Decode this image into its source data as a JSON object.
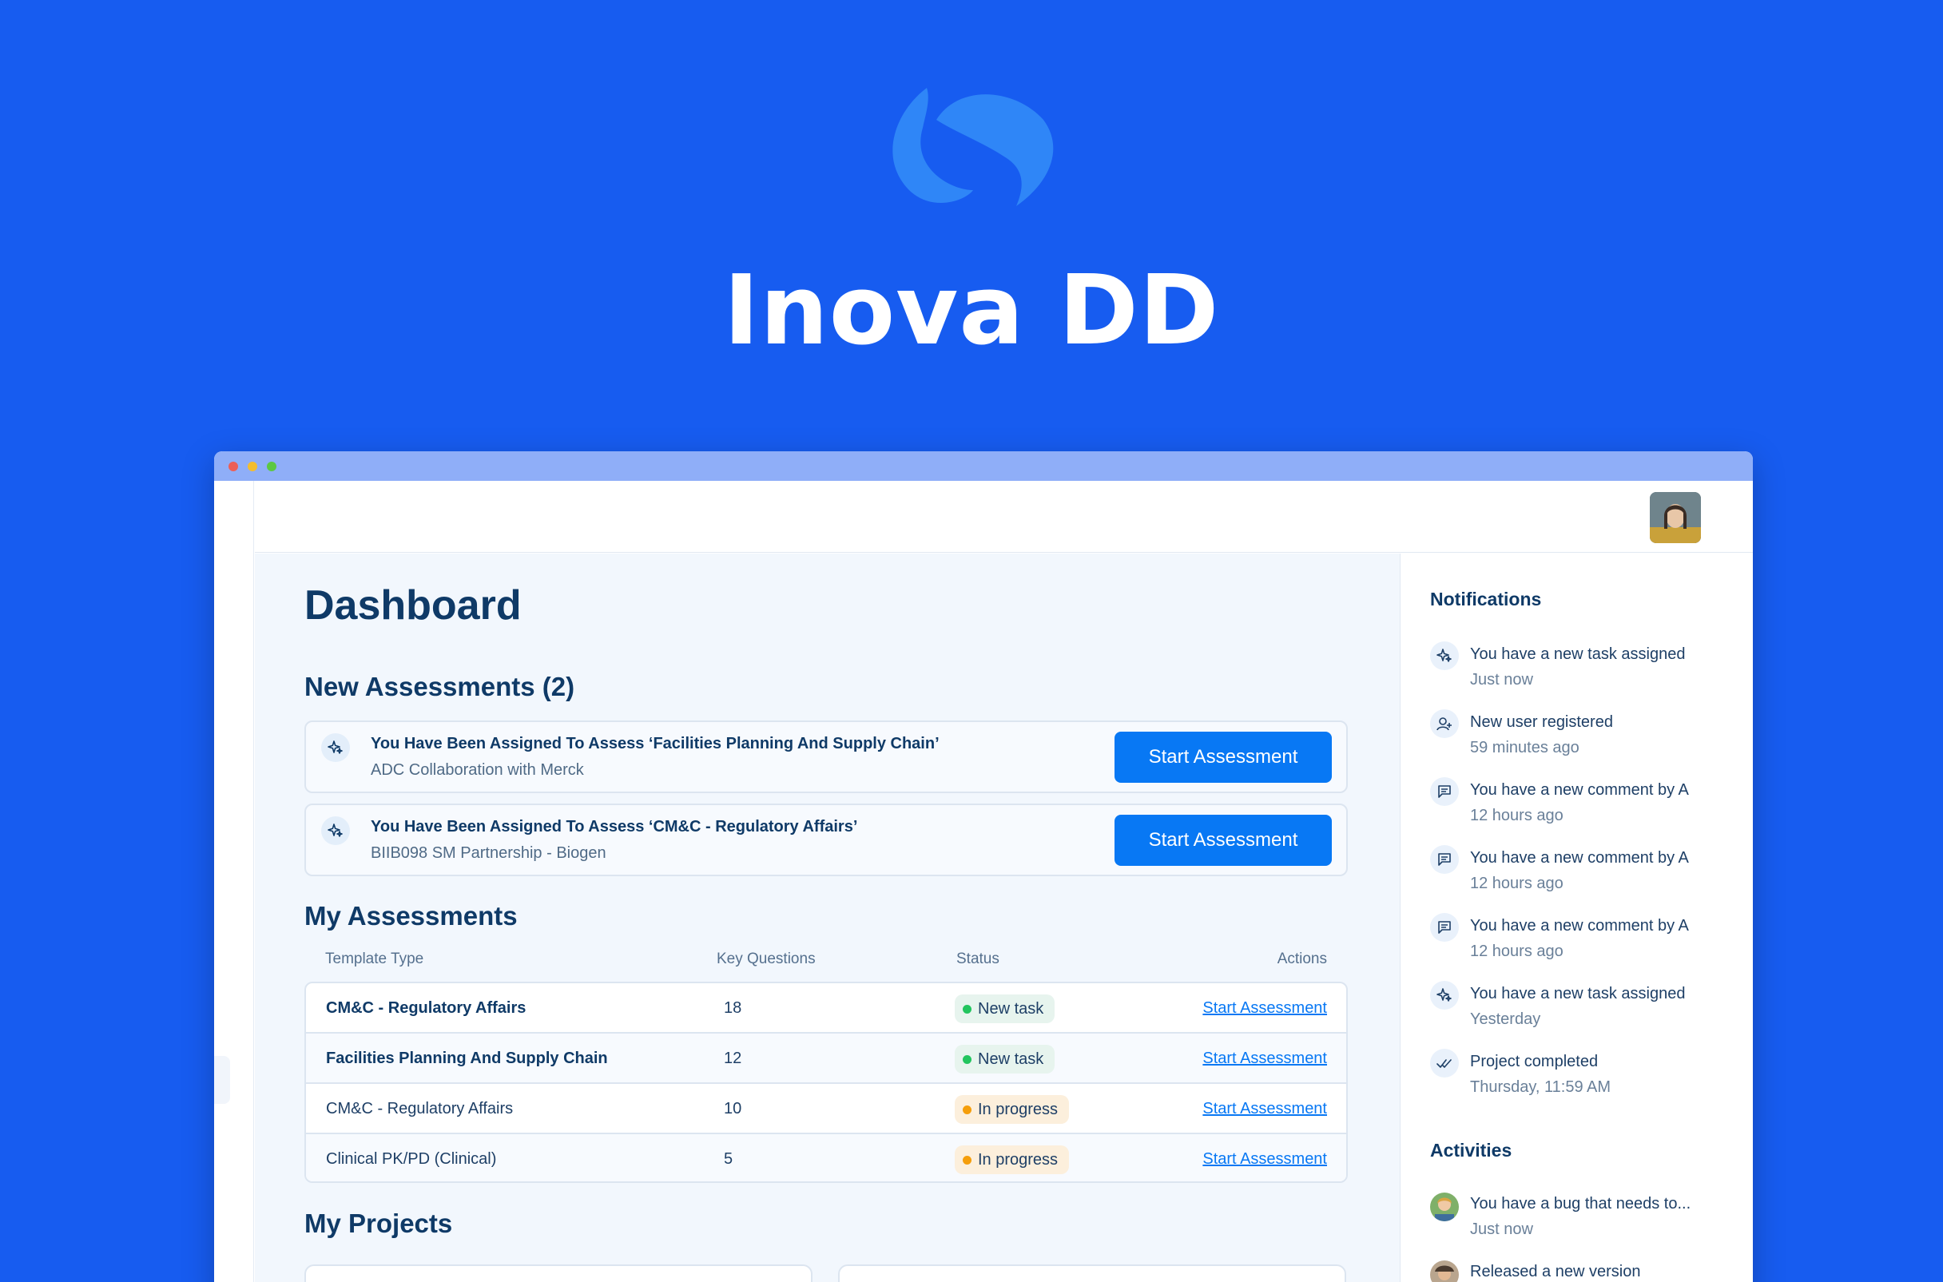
{
  "hero": {
    "title": "Inova DD",
    "logo_icon": "inova-logo-icon",
    "background_color": "#175CF0"
  },
  "window": {
    "traffic_lights": [
      "#EC5E56",
      "#F3BD2E",
      "#5CC842"
    ],
    "user_avatar": "user-avatar"
  },
  "dashboard": {
    "title": "Dashboard",
    "new_assessments": {
      "heading": "New Assessments (2)",
      "items": [
        {
          "title": "You Have Been Assigned To Assess ‘Facilities Planning And Supply Chain’",
          "subtitle": "ADC Collaboration with Merck",
          "button": "Start Assessment"
        },
        {
          "title": "You Have Been Assigned To Assess ‘CM&C - Regulatory Affairs’",
          "subtitle": "BIIB098 SM Partnership - Biogen",
          "button": "Start Assessment"
        }
      ]
    },
    "my_assessments": {
      "heading": "My Assessments",
      "columns": [
        "Template Type",
        "Key Questions",
        "Status",
        "Actions"
      ],
      "rows": [
        {
          "template": "CM&C - Regulatory Affairs",
          "key_questions": "18",
          "status": "New task",
          "action": "Start Assessment"
        },
        {
          "template": "Facilities Planning And Supply Chain",
          "key_questions": "12",
          "status": "New task",
          "action": "Start Assessment"
        },
        {
          "template": "CM&C - Regulatory Affairs",
          "key_questions": "10",
          "status": "In progress",
          "action": "Start Assessment"
        },
        {
          "template": "Clinical PK/PD (Clinical)",
          "key_questions": "5",
          "status": "In progress",
          "action": "Start Assessment"
        }
      ],
      "status_colors": {
        "New task": "#22C55E",
        "In progress": "#F59E0B"
      }
    },
    "my_projects": {
      "heading": "My Projects"
    }
  },
  "notifications": {
    "heading": "Notifications",
    "items": [
      {
        "icon": "sparkle-icon",
        "text": "You have a new task assigned",
        "time": "Just now"
      },
      {
        "icon": "user-add-icon",
        "text": "New user registered",
        "time": "59 minutes ago"
      },
      {
        "icon": "comment-icon",
        "text": "You have a new comment by A",
        "time": "12 hours ago"
      },
      {
        "icon": "comment-icon",
        "text": "You have a new comment by A",
        "time": "12 hours ago"
      },
      {
        "icon": "comment-icon",
        "text": "You have a new comment by A",
        "time": "12 hours ago"
      },
      {
        "icon": "sparkle-icon",
        "text": "You have a new task assigned",
        "time": "Yesterday"
      },
      {
        "icon": "double-check-icon",
        "text": "Project completed",
        "time": "Thursday, 11:59 AM"
      }
    ]
  },
  "activities": {
    "heading": "Activities",
    "items": [
      {
        "icon": "user-avatar",
        "text": "You have a bug that needs to...",
        "time": "Just now"
      },
      {
        "icon": "user-avatar",
        "text": "Released a new version",
        "time": ""
      }
    ]
  }
}
